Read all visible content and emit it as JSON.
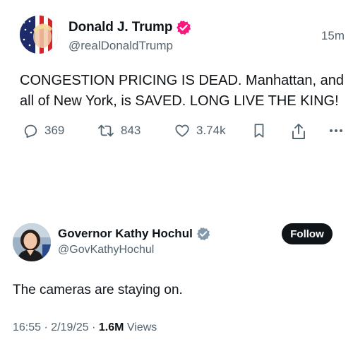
{
  "post1": {
    "display_name": "Donald J. Trump",
    "handle": "@realDonaldTrump",
    "time": "15m",
    "text": "CONGESTION PRICING IS DEAD. Manhattan, and all of New York, is SAVED. LONG LIVE THE KING!",
    "verified_badge_color": "#f91880",
    "actions": {
      "replies": "369",
      "reposts": "843",
      "likes": "3.74k",
      "bookmark_icon": "bookmark-icon",
      "share_icon": "share-icon",
      "more_icon": "more-icon"
    }
  },
  "post2": {
    "display_name": "Governor Kathy Hochul",
    "handle": "@GovKathyHochul",
    "verified_badge_color": "#829aab",
    "follow_label": "Follow",
    "text": "The cameras are staying on.",
    "timestamp": "16:55 · 2/19/25 · ",
    "views_count": "1.6M",
    "views_label": " Views"
  },
  "colors": {
    "text_primary": "#0f1419",
    "text_secondary": "#536471",
    "follow_button": "#0f1419"
  }
}
